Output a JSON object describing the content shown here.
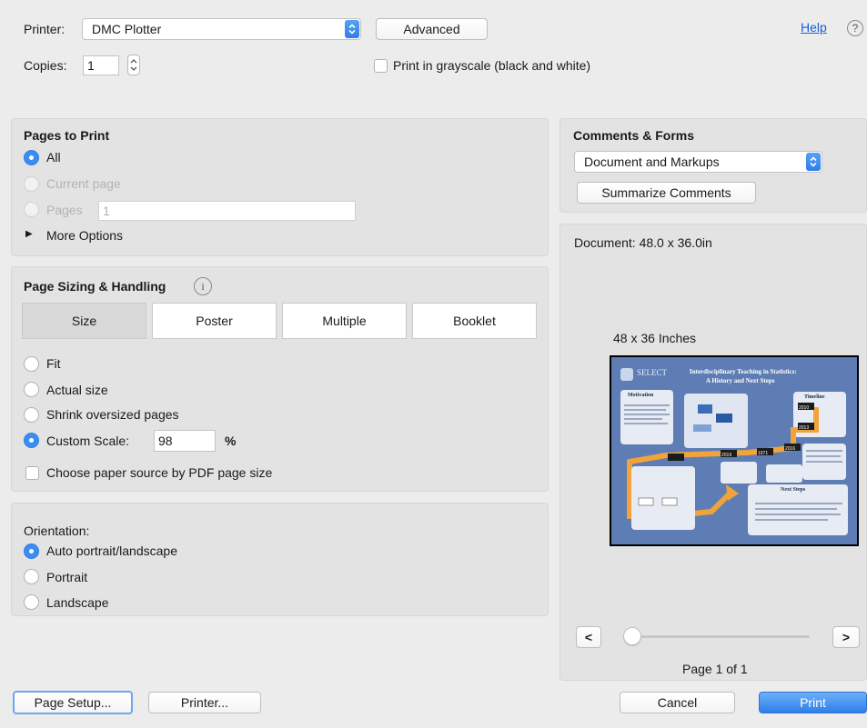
{
  "printer": {
    "label": "Printer:",
    "selected": "DMC Plotter",
    "advanced_label": "Advanced",
    "help_label": "Help",
    "copies_label": "Copies:",
    "copies_value": "1",
    "grayscale_label": "Print in grayscale (black and white)"
  },
  "pages_to_print": {
    "title": "Pages to Print",
    "all_label": "All",
    "current_label": "Current page",
    "pages_label": "Pages",
    "pages_value": "1",
    "more_options_label": "More Options"
  },
  "sizing": {
    "title": "Page Sizing & Handling",
    "tabs": [
      "Size",
      "Poster",
      "Multiple",
      "Booklet"
    ],
    "fit_label": "Fit",
    "actual_label": "Actual size",
    "shrink_label": "Shrink oversized pages",
    "custom_label": "Custom Scale:",
    "custom_value": "98",
    "percent": "%",
    "paper_source_label": "Choose paper source by PDF page size"
  },
  "orientation": {
    "title": "Orientation:",
    "auto_label": "Auto portrait/landscape",
    "portrait_label": "Portrait",
    "landscape_label": "Landscape"
  },
  "comments": {
    "title": "Comments & Forms",
    "selected": "Document and Markups",
    "summarize_label": "Summarize Comments"
  },
  "preview": {
    "document_size": "Document: 48.0 x 36.0in",
    "page_caption": "48 x 36 Inches",
    "poster_title_1": "Interdisciplinary Teaching in Statistics:",
    "poster_title_2": "A History and Next Steps",
    "poster_logo": "SELECT",
    "poster_motivation": "Motivation",
    "poster_timeline": "Timeline",
    "poster_next_steps": "Next Steps",
    "years": [
      "2010",
      "2013",
      "2016",
      "1971",
      "2019"
    ],
    "prev_label": "<",
    "next_label": ">",
    "page_indicator": "Page 1 of 1"
  },
  "footer": {
    "page_setup_label": "Page Setup...",
    "printer_label": "Printer...",
    "cancel_label": "Cancel",
    "print_label": "Print"
  },
  "colors": {
    "accent": "#3b8ef0",
    "poster_bg": "#5e7db4",
    "poster_path": "#f2a33a"
  }
}
